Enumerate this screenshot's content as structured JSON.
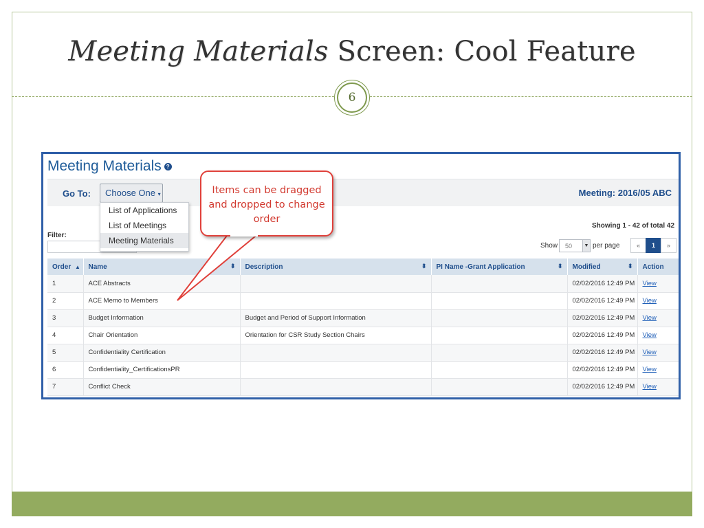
{
  "slide": {
    "title_emph": "Meeting Materials",
    "title_rest": " Screen: Cool Feature",
    "page_number": "6",
    "colors": {
      "frame": "#b6c79a",
      "footer": "#93ab5f",
      "accent": "#7f9a4e"
    }
  },
  "app": {
    "title": "Meeting Materials",
    "help_icon": "question-circle-icon",
    "goto_label": "Go To:",
    "goto_button": "Choose One",
    "meeting_label": "Meeting: 2016/05 ABC",
    "dropdown": [
      "List of Applications",
      "List of Meetings",
      "Meeting Materials"
    ],
    "filter_label": "Filter:",
    "showing": "Showing 1 - 42 of total 42",
    "show_label": "Show",
    "per_page_value": "50",
    "per_page_label": "per page",
    "pager": {
      "prev": "«",
      "current": "1",
      "next": "»"
    },
    "columns": [
      "Order",
      "Name",
      "Description",
      "PI Name -Grant Application",
      "Modified",
      "Action"
    ],
    "rows": [
      [
        "1",
        "ACE Abstracts",
        "",
        "",
        "02/02/2016 12:49 PM",
        "View"
      ],
      [
        "2",
        "ACE Memo to Members",
        "",
        "",
        "02/02/2016 12:49 PM",
        "View"
      ],
      [
        "3",
        "Budget Information",
        "Budget and Period of Support Information",
        "",
        "02/02/2016 12:49 PM",
        "View"
      ],
      [
        "4",
        "Chair Orientation",
        "Orientation for CSR Study Section Chairs",
        "",
        "02/02/2016 12:49 PM",
        "View"
      ],
      [
        "5",
        "Confidentiality Certification",
        "",
        "",
        "02/02/2016 12:49 PM",
        "View"
      ],
      [
        "6",
        "Confidentiality_CertificationsPR",
        "",
        "",
        "02/02/2016 12:49 PM",
        "View"
      ],
      [
        "7",
        "Conflict Check",
        "",
        "",
        "02/02/2016 12:49 PM",
        "View"
      ]
    ],
    "colors": {
      "primary": "#1f4e8c",
      "header_bg": "#d6e1ec",
      "link": "#1f5fb8"
    }
  },
  "callout": {
    "lines": [
      "Items can be dragged",
      "and dropped to change",
      "order"
    ],
    "color": "#e0403a"
  }
}
